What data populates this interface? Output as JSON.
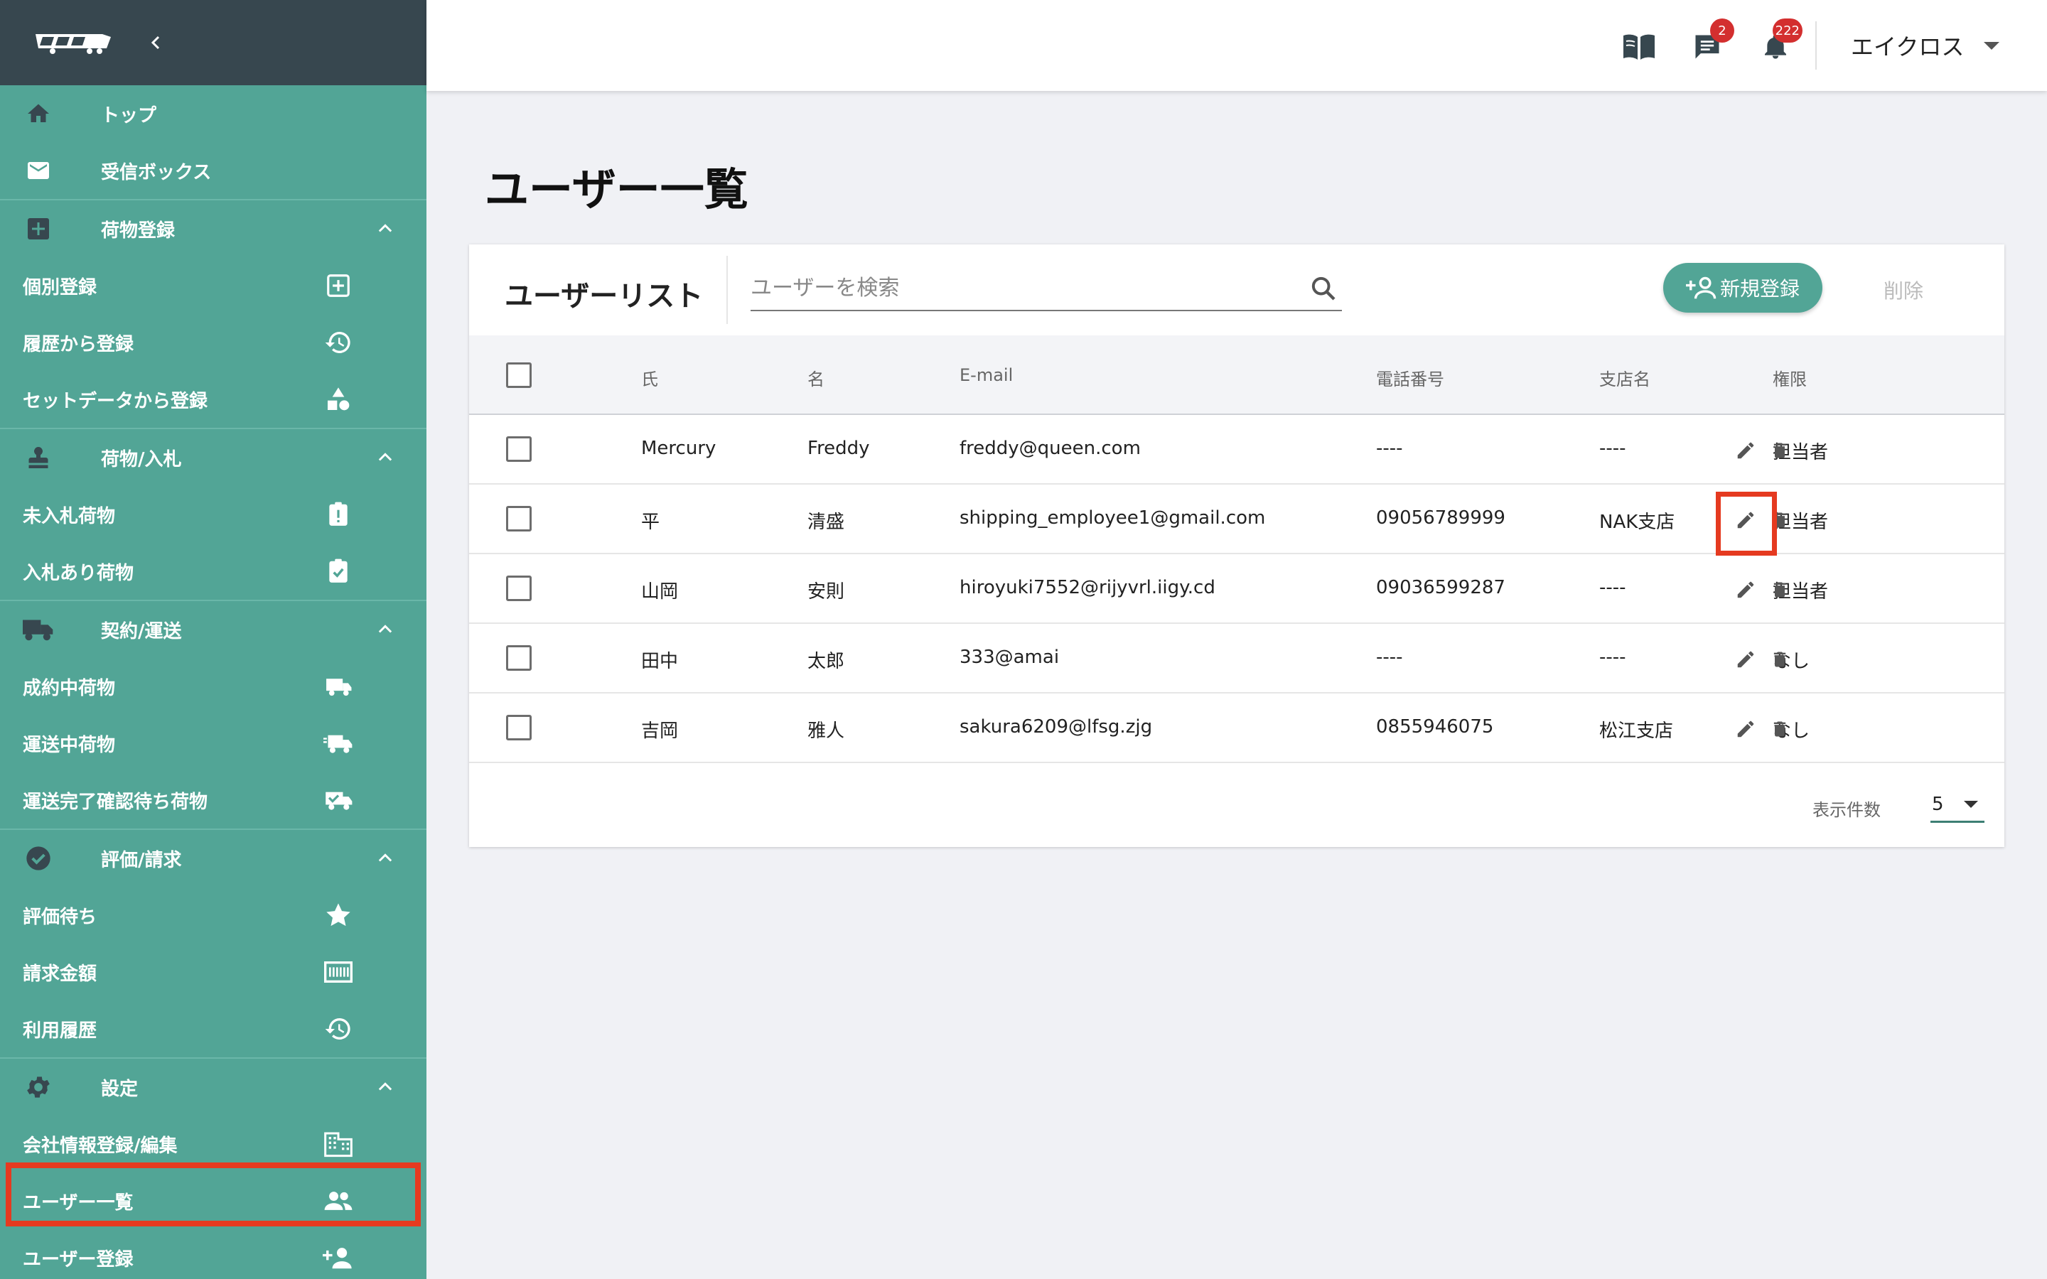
{
  "sidebar": {
    "items": [
      {
        "label": "トップ",
        "icon": "home-icon"
      },
      {
        "label": "受信ボックス",
        "icon": "mail-icon"
      },
      {
        "label": "荷物登録",
        "icon": "add-box-icon"
      },
      {
        "label": "個別登録",
        "icon": "add-square-icon"
      },
      {
        "label": "履歴から登録",
        "icon": "history-icon"
      },
      {
        "label": "セットデータから登録",
        "icon": "shapes-icon"
      },
      {
        "label": "荷物/入札",
        "icon": "stamp-icon"
      },
      {
        "label": "未入札荷物",
        "icon": "clipboard-alert-icon"
      },
      {
        "label": "入札あり荷物",
        "icon": "clipboard-check-icon"
      },
      {
        "label": "契約/運送",
        "icon": "truck-icon"
      },
      {
        "label": "成約中荷物",
        "icon": "truck-small-icon"
      },
      {
        "label": "運送中荷物",
        "icon": "truck-fast-icon"
      },
      {
        "label": "運送完了確認待ち荷物",
        "icon": "truck-check-icon"
      },
      {
        "label": "評価/請求",
        "icon": "check-circle-icon"
      },
      {
        "label": "評価待ち",
        "icon": "star-icon"
      },
      {
        "label": "請求金額",
        "icon": "invoice-icon"
      },
      {
        "label": "利用履歴",
        "icon": "history-icon"
      },
      {
        "label": "設定",
        "icon": "gear-icon"
      },
      {
        "label": "会社情報登録/編集",
        "icon": "building-icon"
      },
      {
        "label": "ユーザー一覧",
        "icon": "people-icon"
      },
      {
        "label": "ユーザー登録",
        "icon": "person-add-icon"
      }
    ]
  },
  "header": {
    "messages_badge": "2",
    "notifications_badge": "222",
    "company_name": "エイクロス"
  },
  "main": {
    "page_title": "ユーザー一覧",
    "list_title": "ユーザーリスト",
    "search_placeholder": "ユーザーを検索",
    "new_button": "新規登録",
    "delete_button": "削除",
    "columns": [
      "氏",
      "名",
      "E-mail",
      "電話番号",
      "支店名",
      "権限"
    ],
    "rows": [
      {
        "last": "Mercury",
        "first": "Freddy",
        "email": "freddy@queen.com",
        "phone": "----",
        "branch": "----",
        "role": "担当者"
      },
      {
        "last": "平",
        "first": "清盛",
        "email": "shipping_employee1@gmail.com",
        "phone": "09056789999",
        "branch": "NAK支店",
        "role": "担当者"
      },
      {
        "last": "山岡",
        "first": "安則",
        "email": "hiroyuki7552@rijyvrl.iigy.cd",
        "phone": "09036599287",
        "branch": "----",
        "role": "担当者"
      },
      {
        "last": "田中",
        "first": "太郎",
        "email": "333@amai",
        "phone": "----",
        "branch": "----",
        "role": "なし"
      },
      {
        "last": "吉岡",
        "first": "雅人",
        "email": "sakura6209@lfsg.zjg",
        "phone": "0855946075",
        "branch": "松江支店",
        "role": "なし"
      }
    ],
    "rows_per_page_label": "表示件数",
    "rows_per_page": "5"
  },
  "colors": {
    "sidebar": "#52a596",
    "sidebar_header": "#37474f",
    "highlight": "#e53a20",
    "badge": "#d32f2f"
  }
}
